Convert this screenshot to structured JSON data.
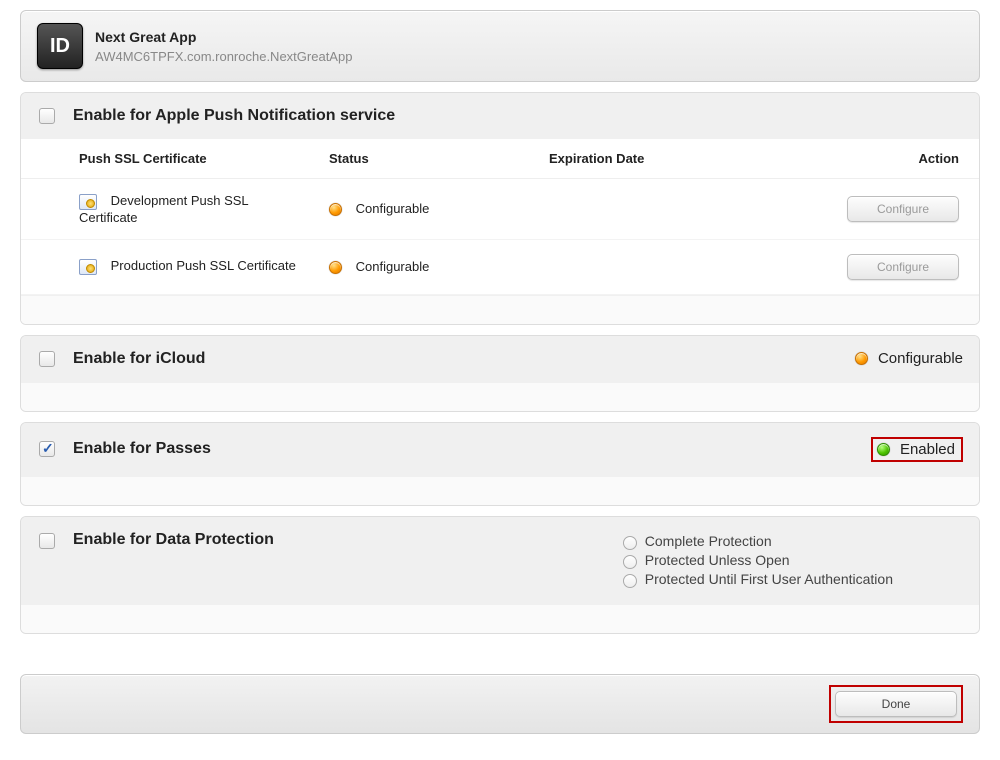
{
  "header": {
    "badge_text": "ID",
    "app_name": "Next Great App",
    "bundle_id": "AW4MC6TPFX.com.ronroche.NextGreatApp"
  },
  "push": {
    "title": "Enable for Apple Push Notification service",
    "checked": false,
    "columns": {
      "cert": "Push SSL Certificate",
      "status": "Status",
      "exp": "Expiration Date",
      "action": "Action"
    },
    "rows": [
      {
        "name": "Development Push SSL Certificate",
        "status": "Configurable",
        "action_label": "Configure"
      },
      {
        "name": "Production Push SSL Certificate",
        "status": "Configurable",
        "action_label": "Configure"
      }
    ]
  },
  "icloud": {
    "title": "Enable for iCloud",
    "checked": false,
    "status_text": "Configurable"
  },
  "passes": {
    "title": "Enable for Passes",
    "checked": true,
    "status_text": "Enabled"
  },
  "data_protection": {
    "title": "Enable for Data Protection",
    "checked": false,
    "options": [
      "Complete Protection",
      "Protected Unless Open",
      "Protected Until First User Authentication"
    ]
  },
  "footer": {
    "done_label": "Done"
  }
}
